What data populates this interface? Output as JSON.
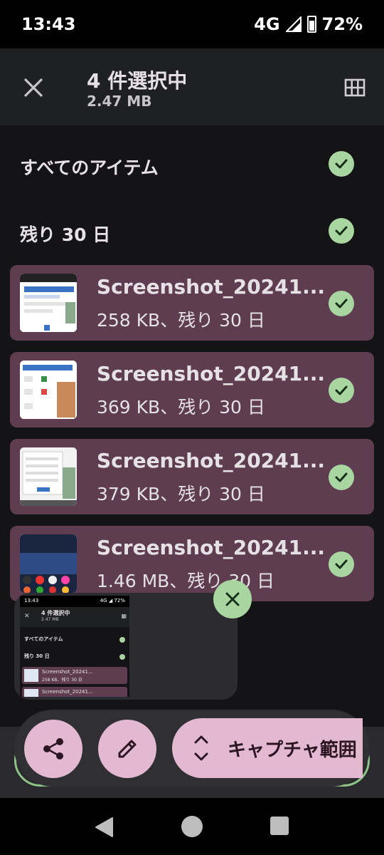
{
  "status_bar": {
    "time": "13:43",
    "network": "4G",
    "battery": "72%"
  },
  "header": {
    "title": "4 件選択中",
    "size": "2.47 MB"
  },
  "sections": {
    "all_items": "すべてのアイテム",
    "group": "残り 30 日"
  },
  "items": [
    {
      "name": "Screenshot_20241...",
      "meta": "258 KB、残り 30 日"
    },
    {
      "name": "Screenshot_20241...",
      "meta": "369 KB、残り 30 日"
    },
    {
      "name": "Screenshot_20241...",
      "meta": "379 KB、残り 30 日"
    },
    {
      "name": "Screenshot_20241...",
      "meta": "1.46 MB、残り 30 日"
    }
  ],
  "preview": {
    "time": "13:43",
    "status": "4G ◢ 72%",
    "title": "4 件選択中",
    "size": "2.47 MB",
    "all_items": "すべてのアイテム",
    "group": "残り 30 日",
    "row1_name": "Screenshot_20241...",
    "row1_meta": "258 KB、残り 30 日",
    "row2_name": "Screenshot_20241..."
  },
  "toolbar": {
    "capture_label": "キャプチャ範囲"
  },
  "colors": {
    "accent_check": "#a8d5a0",
    "row_bg": "#5e3d50",
    "button_bg": "#e2b9d1"
  }
}
